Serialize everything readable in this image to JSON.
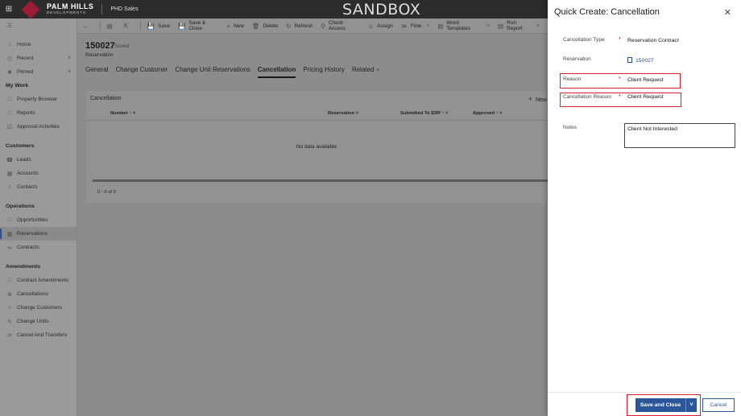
{
  "topbar": {
    "logo_line1": "PALM HILLS",
    "logo_line2": "DEVELOPMENTS",
    "app_name": "PHD Sales",
    "env_banner": "SANDBOX"
  },
  "sidebar": {
    "home": "Home",
    "recent": "Recent",
    "pinned": "Pinned",
    "my_work": "My Work",
    "property_browser": "Property Browser",
    "reports": "Reports",
    "approval_activities": "Approval Activities",
    "customers": "Customers",
    "leads": "Leads",
    "accounts": "Accounts",
    "contacts": "Contacts",
    "operations": "Operations",
    "opportunities": "Opportunities",
    "reservations": "Reservations",
    "contracts": "Contracts",
    "amendments": "Amendments",
    "contract_amendments": "Contract Amendments",
    "cancellations": "Cancellations",
    "change_customers": "Change Customers",
    "change_units": "Change Units",
    "cancel_and_transfers": "Cancel And Transfers"
  },
  "commandbar": {
    "save": "Save",
    "save_close": "Save & Close",
    "new": "New",
    "delete": "Delete",
    "refresh": "Refresh",
    "check_access": "Check Access",
    "assign": "Assign",
    "flow": "Flow",
    "word_templates": "Word Templates",
    "run_report": "Run Report"
  },
  "record": {
    "title": "150027",
    "saved_status": "- Saved",
    "entity": "Reservation"
  },
  "tabs": {
    "general": "General",
    "change_customer": "Change Customer",
    "change_unit_reservations": "Change Unit Reservations",
    "cancellation": "Cancellation",
    "pricing_history": "Pricing History",
    "related": "Related"
  },
  "grid": {
    "title": "Cancellation",
    "new_label": "New",
    "col_number": "Number ↑ ˅",
    "col_reservation": "Reservation ˅",
    "col_submitted": "Submitted To ERP ↑ ˅",
    "col_approved": "Approved ↑ ˅",
    "empty_message": "No data available",
    "pager": "0 - 0 of 0"
  },
  "quick_create": {
    "title": "Quick Create: Cancellation",
    "cancellation_type_label": "Cancellation Type",
    "cancellation_type_value": "Reservation Contract",
    "reservation_label": "Reservation",
    "reservation_value": "150027",
    "reason_label": "Reason",
    "reason_value": "Client Request",
    "cancellation_reason_label": "Cancellation Reason",
    "cancellation_reason_value": "Client Request",
    "notes_label": "Notes",
    "notes_value": "Client Not Interested",
    "required_marker": "*",
    "save_close_button": "Save and Close",
    "cancel_button": "Cancel"
  },
  "colors": {
    "primary": "#2b579a",
    "highlight": "#e01d2a",
    "brand": "#9b1c35",
    "topbar": "#2c2c2c"
  }
}
